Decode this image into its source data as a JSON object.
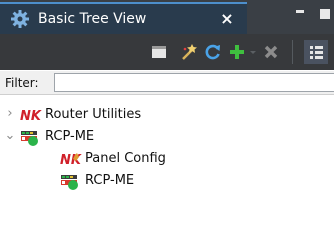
{
  "view": {
    "title": "Basic Tree View",
    "close_glyph": "×"
  },
  "toolbar": {
    "icons": [
      "minimize-panel-icon",
      "wizard-wand-icon",
      "refresh-icon",
      "add-icon",
      "dropdown-arrow-icon",
      "remove-icon",
      "tree-layout-icon"
    ]
  },
  "filter": {
    "label": "Filter:",
    "value": "",
    "placeholder": ""
  },
  "tree": {
    "items": [
      {
        "label": "Router Utilities",
        "icon": "nk-icon",
        "expanded": false
      },
      {
        "label": "RCP-ME",
        "icon": "rcp-me-icon",
        "expanded": true
      },
      {
        "label": "Panel Config",
        "icon": "nk-icon"
      },
      {
        "label": "RCP-ME",
        "icon": "rcp-me-icon"
      }
    ]
  },
  "colors": {
    "title_bar": "#3a3f45",
    "active_tab": "#293b4d",
    "toolbar": "#37393c",
    "nk_red": "#d0202a",
    "add_green": "#3fbf3f",
    "refresh_blue": "#4aa3e8"
  }
}
